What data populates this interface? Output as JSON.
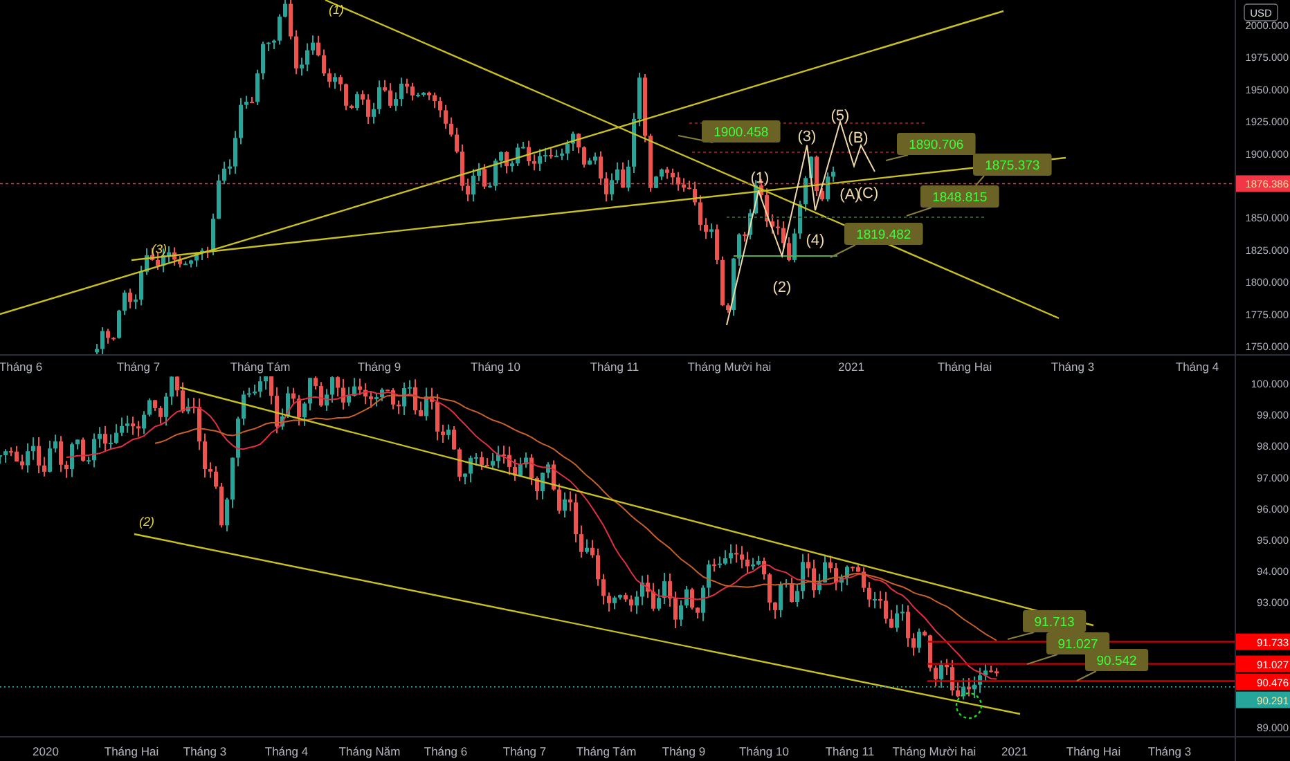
{
  "top_panel": {
    "currency": "USD",
    "price_axis": [
      "2000.000",
      "1975.000",
      "1950.000",
      "1925.000",
      "1900.000",
      "1850.000",
      "1825.000",
      "1800.000",
      "1775.000",
      "1750.000"
    ],
    "current_price": {
      "text": "1876.386",
      "color": "#f23645"
    },
    "wave_labels": [
      {
        "text": "(1)",
        "kind": "minor"
      },
      {
        "text": "(3)",
        "kind": "minor"
      },
      {
        "text": "(1)",
        "kind": "wave"
      },
      {
        "text": "(2)",
        "kind": "wave"
      },
      {
        "text": "(3)",
        "kind": "wave"
      },
      {
        "text": "(4)",
        "kind": "wave"
      },
      {
        "text": "(5)",
        "kind": "wave"
      },
      {
        "text": "(A)",
        "kind": "wave"
      },
      {
        "text": "(B)",
        "kind": "wave"
      },
      {
        "text": "(C)",
        "kind": "wave"
      }
    ],
    "price_tags": [
      "1900.458",
      "1890.706",
      "1875.373",
      "1848.815",
      "1819.482"
    ],
    "time_axis": [
      "Tháng 6",
      "Tháng 7",
      "Tháng Tám",
      "Tháng 9",
      "Tháng 10",
      "Tháng 11",
      "Tháng Mười hai",
      "2021",
      "Tháng Hai",
      "Tháng 3",
      "Tháng 4"
    ]
  },
  "bottom_panel": {
    "price_axis": [
      "100.000",
      "99.000",
      "98.000",
      "97.000",
      "96.000",
      "95.000",
      "94.000",
      "93.000",
      "89.000"
    ],
    "price_markers": [
      {
        "text": "91.733",
        "color": "#ff0000"
      },
      {
        "text": "91.027",
        "color": "#ff0000"
      },
      {
        "text": "90.476",
        "color": "#ff0000"
      },
      {
        "text": "90.291",
        "color": "#26a69a"
      }
    ],
    "wave_labels": [
      {
        "text": "(2)",
        "kind": "minor"
      }
    ],
    "price_tags": [
      "91.713",
      "91.027",
      "90.542"
    ],
    "time_axis": [
      "2020",
      "Tháng Hai",
      "Tháng 3",
      "Tháng 4",
      "Tháng Năm",
      "Tháng 6",
      "Tháng 7",
      "Tháng Tám",
      "Tháng 9",
      "Tháng 10",
      "Tháng 11",
      "Tháng Mười hai",
      "2021",
      "Tháng Hai",
      "Tháng 3"
    ]
  }
}
